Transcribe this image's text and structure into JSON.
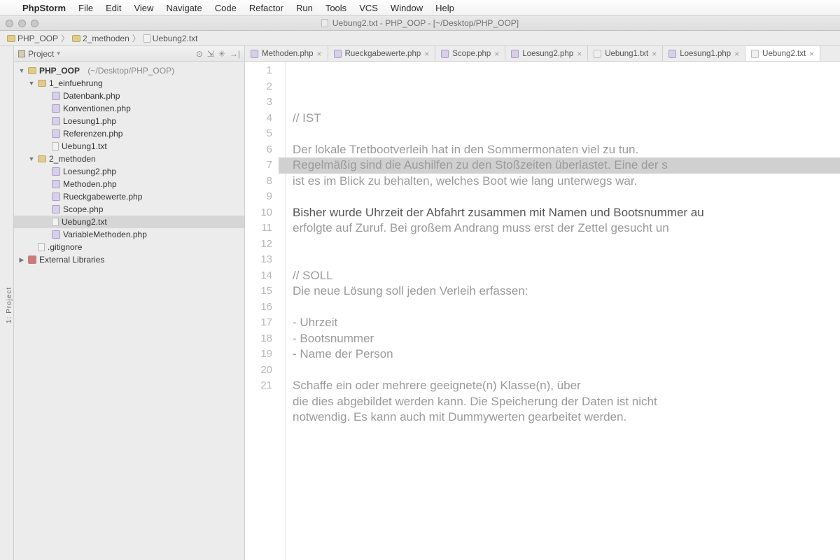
{
  "menubar": {
    "app": "PhpStorm",
    "items": [
      "File",
      "Edit",
      "View",
      "Navigate",
      "Code",
      "Refactor",
      "Run",
      "Tools",
      "VCS",
      "Window",
      "Help"
    ]
  },
  "window": {
    "title": "Uebung2.txt - PHP_OOP - [~/Desktop/PHP_OOP]"
  },
  "breadcrumb": [
    {
      "icon": "folder",
      "label": "PHP_OOP"
    },
    {
      "icon": "folder",
      "label": "2_methoden"
    },
    {
      "icon": "file",
      "label": "Uebung2.txt"
    }
  ],
  "left_rail": {
    "label": "1: Project"
  },
  "project_panel": {
    "title": "Project",
    "tree": {
      "root": {
        "name": "PHP_OOP",
        "path": "(~/Desktop/PHP_OOP)"
      },
      "folder1": {
        "name": "1_einfuehrung",
        "files": [
          "Datenbank.php",
          "Konventionen.php",
          "Loesung1.php",
          "Referenzen.php",
          "Uebung1.txt"
        ]
      },
      "folder2": {
        "name": "2_methoden",
        "files": [
          "Loesung2.php",
          "Methoden.php",
          "Rueckgabewerte.php",
          "Scope.php",
          "Uebung2.txt",
          "VariableMethoden.php"
        ]
      },
      "gitignore": ".gitignore",
      "extlib": "External Libraries"
    },
    "selected": "Uebung2.txt"
  },
  "tabs": [
    {
      "label": "Methoden.php",
      "type": "php"
    },
    {
      "label": "Rueckgabewerte.php",
      "type": "php"
    },
    {
      "label": "Scope.php",
      "type": "php"
    },
    {
      "label": "Loesung2.php",
      "type": "php"
    },
    {
      "label": "Uebung1.txt",
      "type": "txt"
    },
    {
      "label": "Loesung1.php",
      "type": "php"
    },
    {
      "label": "Uebung2.txt",
      "type": "txt",
      "active": true
    }
  ],
  "editor": {
    "highlighted_line": 7,
    "lines": [
      "// IST",
      "",
      "Der lokale Tretbootverleih hat in den Sommermonaten viel zu tun.",
      "Regelmäßig sind die Aushilfen zu den Stoßzeiten überlastet. Eine der s",
      "ist es im Blick zu behalten, welches Boot wie lang unterwegs war.",
      "",
      "Bisher wurde Uhrzeit der Abfahrt zusammen mit Namen und Bootsnummer au",
      "erfolgte auf Zuruf. Bei großem Andrang muss erst der Zettel gesucht un",
      "",
      "",
      "// SOLL",
      "Die neue Lösung soll jeden Verleih erfassen:",
      "",
      "- Uhrzeit",
      "- Bootsnummer",
      "- Name der Person",
      "",
      "Schaffe ein oder mehrere geeignete(n) Klasse(n), über",
      "die dies abgebildet werden kann. Die Speicherung der Daten ist nicht",
      "notwendig. Es kann auch mit Dummywerten gearbeitet werden.",
      ""
    ]
  }
}
